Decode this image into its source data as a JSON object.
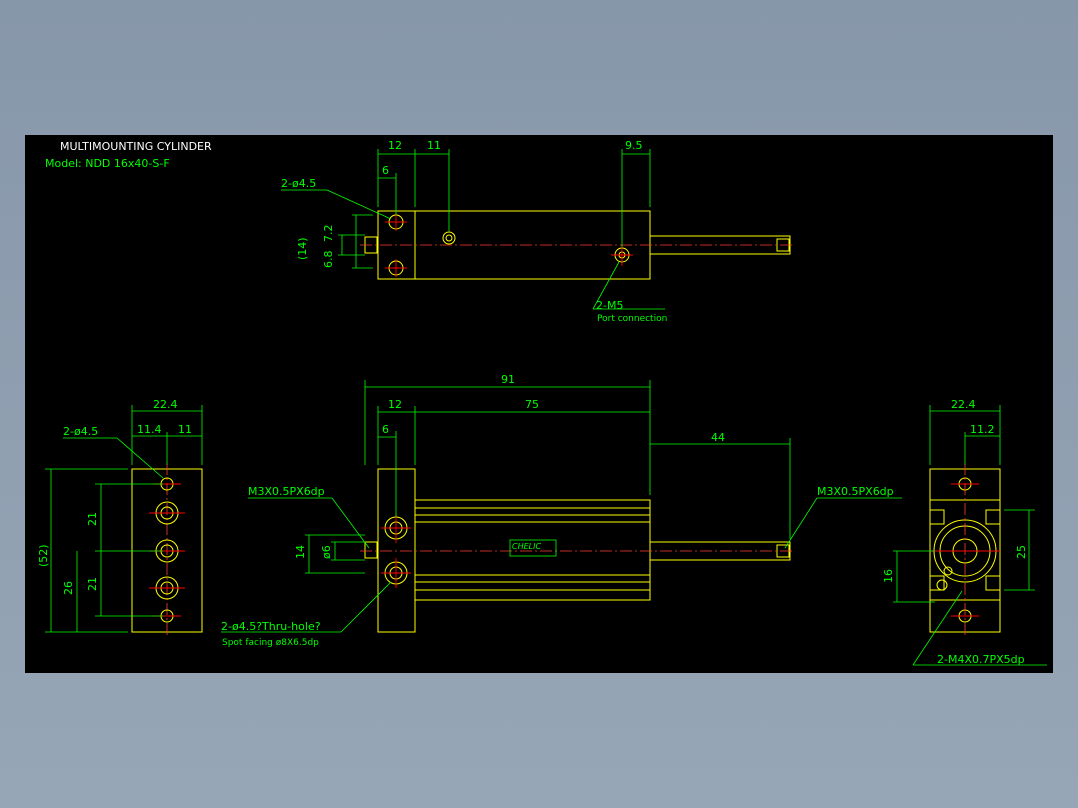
{
  "title": "MULTIMOUNTING CYLINDER",
  "model": "Model: NDD 16x40-S-F",
  "colors": {
    "background": "#8b9bad",
    "frame": "#000000",
    "outline": "#ffff00",
    "dimension": "#00ff00",
    "centerline": "#ff0000",
    "title_text": "#ffffff"
  },
  "top_view": {
    "dims": {
      "d12": "12",
      "d11": "11",
      "d9_5": "9.5",
      "d6": "6",
      "d14": "(14)",
      "d6_8": "6.8",
      "d7_2": "7.2"
    },
    "hole_note": "2-ø4.5",
    "port_note": "2-M5",
    "port_sub": "Port connection"
  },
  "side_view": {
    "dims": {
      "d22_4": "22.4",
      "d11_4": "11.4",
      "d11": "11",
      "d52": "(52)",
      "d21a": "21",
      "d21b": "21",
      "d26": "26"
    },
    "hole_note": "2-ø4.5"
  },
  "front_view": {
    "dims": {
      "d91": "91",
      "d12": "12",
      "d75": "75",
      "d6": "6",
      "d44": "44",
      "d14": "14",
      "d6b": "ø6"
    },
    "thread_left": "M3X0.5PX6dp",
    "thread_right": "M3X0.5PX6dp",
    "thru_note": "2-ø4.5?Thru-hole?",
    "spot_note": "Spot facing  ø8X6.5dp",
    "logo": "CHELIC"
  },
  "end_view": {
    "dims": {
      "d22_4": "22.4",
      "d11_2": "11.2",
      "d25": "25",
      "d16": "16"
    },
    "thread_note": "2-M4X0.7PX5dp"
  }
}
